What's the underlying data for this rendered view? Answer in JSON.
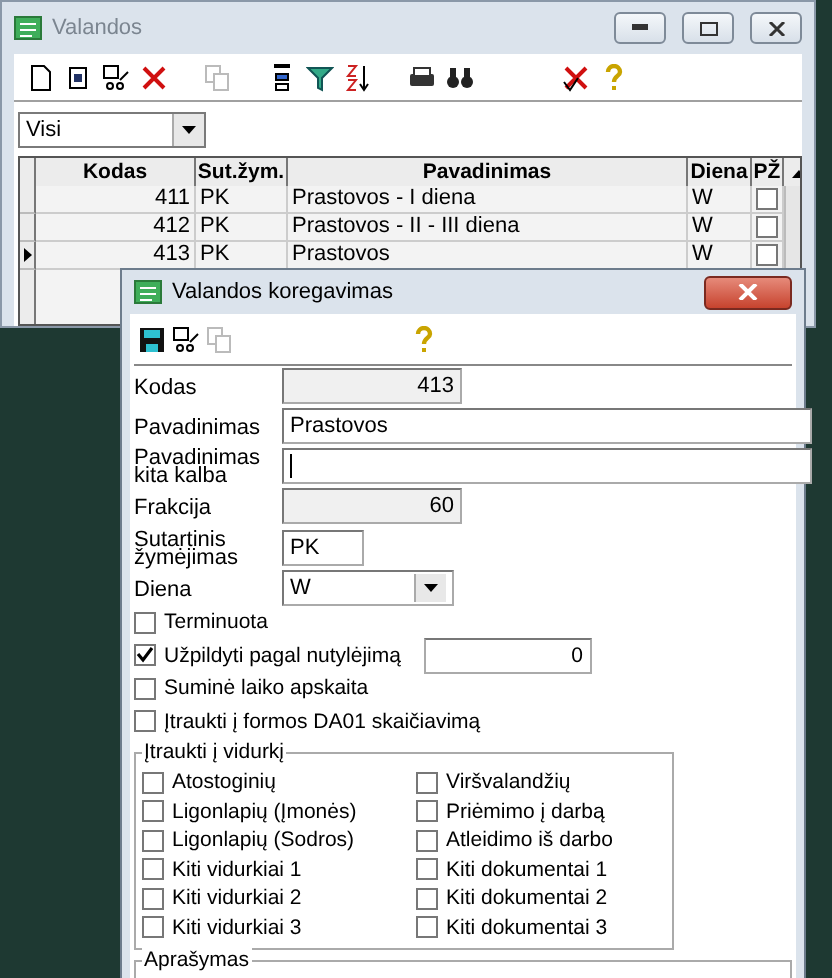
{
  "main_window": {
    "title": "Valandos",
    "filter": {
      "value": "Visi"
    },
    "table": {
      "columns": [
        "Kodas",
        "Sut.žym.",
        "Pavadinimas",
        "Diena",
        "PŽ"
      ],
      "rows": [
        {
          "kodas": "411",
          "zym": "PK",
          "name": "Prastovos - I diena",
          "diena": "W",
          "pz_checked": false,
          "current": false
        },
        {
          "kodas": "412",
          "zym": "PK",
          "name": "Prastovos - II - III diena",
          "diena": "W",
          "pz_checked": false,
          "current": false
        },
        {
          "kodas": "413",
          "zym": "PK",
          "name": "Prastovos",
          "diena": "W",
          "pz_checked": false,
          "current": true
        }
      ]
    }
  },
  "dialog": {
    "title": "Valandos koregavimas",
    "fields": [
      {
        "label": "Kodas",
        "value": "413",
        "kind": "readonly"
      },
      {
        "label": "Pavadinimas",
        "value": "Prastovos",
        "kind": "text"
      },
      {
        "label": "Pavadinimas kita kalba",
        "kind": "text"
      },
      {
        "label": "Frakcija",
        "value": "60",
        "kind": "readonly"
      },
      {
        "label": "Sutartinis žymėjimas",
        "value": "PK",
        "kind": "short"
      },
      {
        "label": "Diena",
        "value": "W",
        "kind": "select"
      }
    ],
    "options": [
      {
        "label": "Terminuota",
        "checked": false
      },
      {
        "label": "Užpildyti pagal nutylėjimą",
        "checked": true,
        "default_value": "0"
      },
      {
        "label": "Suminė laiko apskaita",
        "checked": false
      },
      {
        "label": "Įtraukti į formos DA01 skaičiavimą",
        "checked": false
      }
    ],
    "average_group": {
      "title": "Įtraukti į vidurkį",
      "items": [
        {
          "label": "Atostoginių",
          "checked": false
        },
        {
          "label": "Viršvalandžių",
          "checked": false
        },
        {
          "label": "Ligonlapių (Įmonės)",
          "checked": false
        },
        {
          "label": "Priėmimo į darbą",
          "checked": false
        },
        {
          "label": "Ligonlapių (Sodros)",
          "checked": false
        },
        {
          "label": "Atleidimo iš darbo",
          "checked": false
        },
        {
          "label": "Kiti vidurkiai 1",
          "checked": false
        },
        {
          "label": "Kiti dokumentai 1",
          "checked": false
        },
        {
          "label": "Kiti vidurkiai 2",
          "checked": false
        },
        {
          "label": "Kiti dokumentai 2",
          "checked": false
        },
        {
          "label": "Kiti vidurkiai 3",
          "checked": false
        },
        {
          "label": "Kiti dokumentai 3",
          "checked": false
        }
      ]
    },
    "description": {
      "title": "Aprašymas"
    }
  }
}
